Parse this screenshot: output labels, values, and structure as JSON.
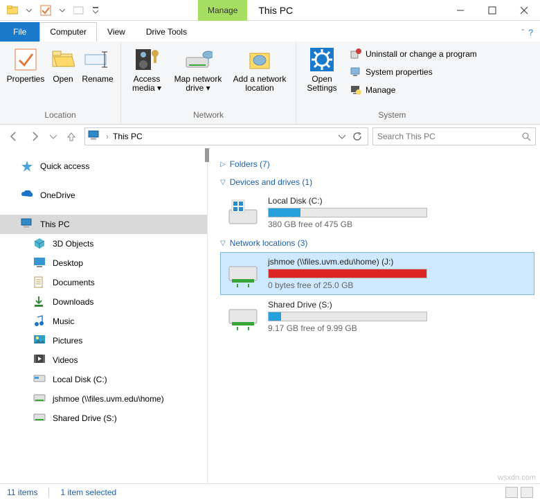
{
  "titlebar": {
    "manage": "Manage",
    "title": "This PC"
  },
  "ribbonTabs": {
    "file": "File",
    "computer": "Computer",
    "view": "View",
    "drive": "Drive Tools"
  },
  "ribbon": {
    "location": {
      "properties": "Properties",
      "open": "Open",
      "rename": "Rename",
      "group": "Location"
    },
    "network": {
      "access": "Access media",
      "map": "Map network drive",
      "add": "Add a network location",
      "group": "Network"
    },
    "settings": {
      "open": "Open Settings",
      "uninstall": "Uninstall or change a program",
      "sysprops": "System properties",
      "manage": "Manage",
      "group": "System"
    }
  },
  "address": {
    "path": "This PC",
    "searchPlaceholder": "Search This PC"
  },
  "nav": {
    "quick": "Quick access",
    "onedrive": "OneDrive",
    "thispc": "This PC",
    "sub": [
      "3D Objects",
      "Desktop",
      "Documents",
      "Downloads",
      "Music",
      "Pictures",
      "Videos",
      "Local Disk (C:)",
      "jshmoe (\\\\files.uvm.edu\\home)",
      "Shared Drive (S:)"
    ]
  },
  "content": {
    "folders": "Folders (7)",
    "drivesHdr": "Devices and drives (1)",
    "netHdr": "Network locations (3)",
    "localC": {
      "name": "Local Disk (C:)",
      "free": "380 GB free of 475 GB",
      "pct": 20
    },
    "netJ": {
      "name": "jshmoe (\\\\files.uvm.edu\\home) (J:)",
      "free": "0 bytes free of 25.0 GB",
      "pct": 100
    },
    "netS": {
      "name": "Shared Drive (S:)",
      "free": "9.17 GB free of 9.99 GB",
      "pct": 8
    }
  },
  "status": {
    "items": "11 items",
    "selected": "1 item selected"
  },
  "watermark": "wsxdn.com"
}
